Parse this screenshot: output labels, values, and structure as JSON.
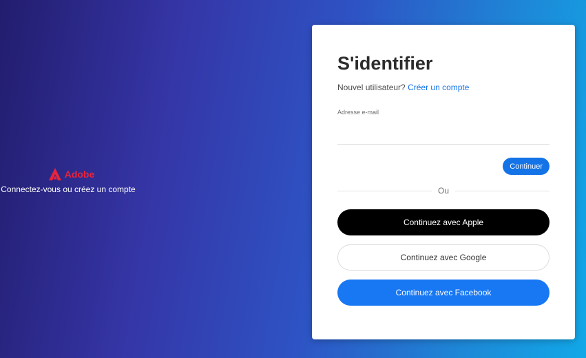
{
  "brand": {
    "logo_icon": "adobe-logo-icon",
    "name": "Adobe",
    "tagline": "Connectez-vous ou créez un compte",
    "color": "#e8243b"
  },
  "signin": {
    "title": "S'identifier",
    "new_user_text": "Nouvel utilisateur?",
    "create_account_link": "Créer un compte",
    "email_label": "Adresse e-mail",
    "email_value": "",
    "continue_button": "Continuer",
    "divider_text": "Ou",
    "apple_button": "Continuez avec Apple",
    "google_button": "Continuez avec Google",
    "facebook_button": "Continuez avec Facebook"
  },
  "colors": {
    "accent": "#1473e6",
    "facebook": "#1877f2",
    "apple": "#000000"
  }
}
